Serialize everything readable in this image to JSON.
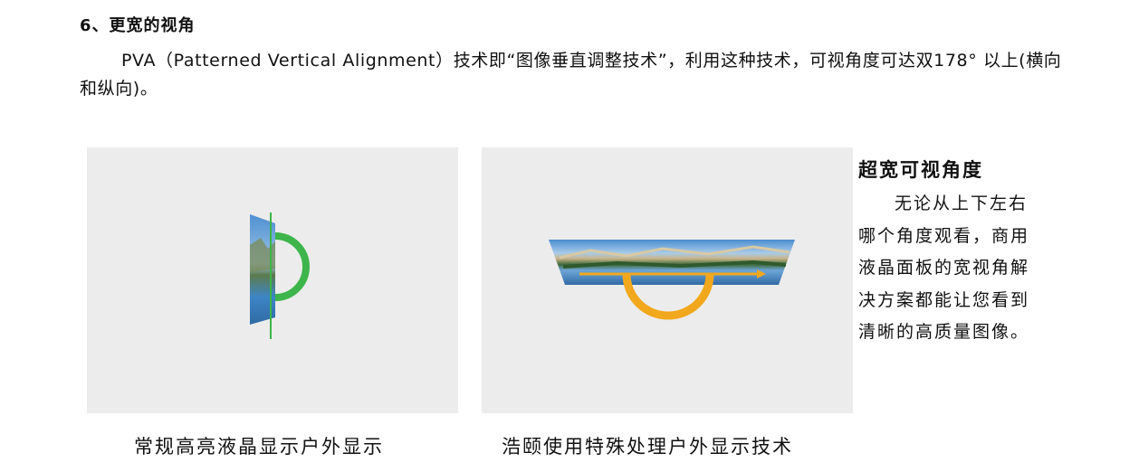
{
  "section": {
    "heading": "6、更宽的视角",
    "paragraph": "PVA（Patterned Vertical Alignment）技术即“图像垂直调整技术”，利用这种技术，可视角度可达双178° 以上(横向和纵向)。"
  },
  "figures": [
    {
      "caption": "常规高亮液晶显示户外显示",
      "arc_color": "#3db54a"
    },
    {
      "caption": "浩颐使用特殊处理户外显示技术",
      "arc_color": "#f2a81d"
    }
  ],
  "sidebar": {
    "title": "超宽可视角度",
    "body": "无论从上下左右哪个角度观看，商用液晶面板的宽视角解决方案都能让您看到清晰的高质量图像。"
  },
  "colors": {
    "panel_bg": "#ececec",
    "sky": "#5aa0d8",
    "mountain": "#b9a98c",
    "forest": "#3f6a3a",
    "water": "#3d86c6"
  }
}
